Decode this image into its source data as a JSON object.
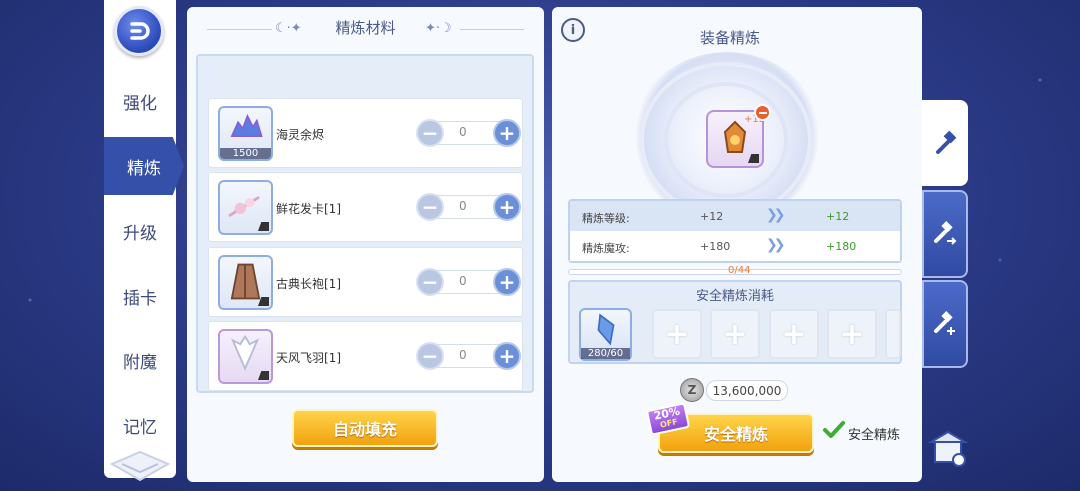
{
  "nav": {
    "items": [
      {
        "label": "强化",
        "active": false
      },
      {
        "label": "精炼",
        "active": true
      },
      {
        "label": "升级",
        "active": false
      },
      {
        "label": "插卡",
        "active": false
      },
      {
        "label": "附魔",
        "active": false
      },
      {
        "label": "记忆",
        "active": false
      }
    ]
  },
  "materials": {
    "title": "精炼材料",
    "items": [
      {
        "name": "海灵余烬",
        "count": "1500",
        "qty": "0",
        "icon": "blue-crystal-pile-icon"
      },
      {
        "name": "鲜花发卡[1]",
        "count": "",
        "qty": "0",
        "icon": "flower-hairpin-icon"
      },
      {
        "name": "古典长袍[1]",
        "count": "",
        "qty": "0",
        "icon": "robe-icon"
      },
      {
        "name": "天风飞羽[1]",
        "count": "",
        "qty": "0",
        "icon": "feather-wings-icon"
      }
    ],
    "auto_fill_label": "自动填充"
  },
  "refine": {
    "title": "装备精炼",
    "equip_level": "+12",
    "stats": [
      {
        "label": "精炼等级:",
        "old": "+12",
        "new": "+12"
      },
      {
        "label": "精炼魔攻:",
        "old": "+180",
        "new": "+180"
      }
    ],
    "progress_text": "0/44",
    "progress_fraction": 0,
    "safe_cost_title": "安全精炼消耗",
    "crystal_count": "280/60",
    "cost": "13,600,000",
    "zeny_symbol": "Z",
    "discount": {
      "percent": "20%",
      "off": "OFF"
    },
    "safe_refine_button": "安全精炼",
    "safe_refine_check_label": "安全精炼",
    "safe_refine_checked": true
  },
  "colors": {
    "accent": "#3550a8",
    "button": "#f2a20f",
    "new_value": "#3a9c2a",
    "progress": "#e87b3a"
  }
}
